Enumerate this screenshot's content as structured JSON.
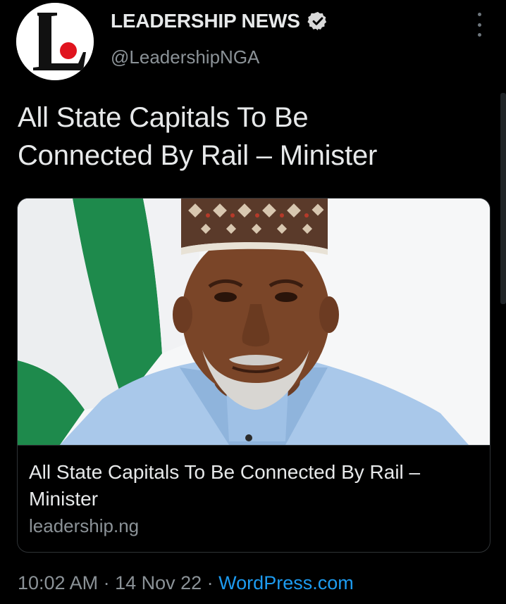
{
  "account": {
    "display_name": "LEADERSHIP NEWS",
    "handle": "@LeadershipNGA",
    "avatar_letter": "L"
  },
  "tweet": {
    "text_line1": "All State Capitals To Be",
    "text_line2": "Connected By Rail – Minister"
  },
  "card": {
    "title_line1": "All State Capitals To Be Connected By Rail –",
    "title_line2": "Minister",
    "domain": "leadership.ng"
  },
  "meta": {
    "time": "10:02 AM",
    "separator1": " · ",
    "date": "14 Nov 22",
    "separator2": " · ",
    "source": "WordPress.com"
  },
  "icons": {
    "verified": "verified-badge-icon",
    "more": "more-options-icon"
  },
  "colors": {
    "background": "#000000",
    "primary_text": "#e7e9ea",
    "secondary_text": "#8b9297",
    "link": "#1d9bf0",
    "logo_red": "#e0141e"
  }
}
